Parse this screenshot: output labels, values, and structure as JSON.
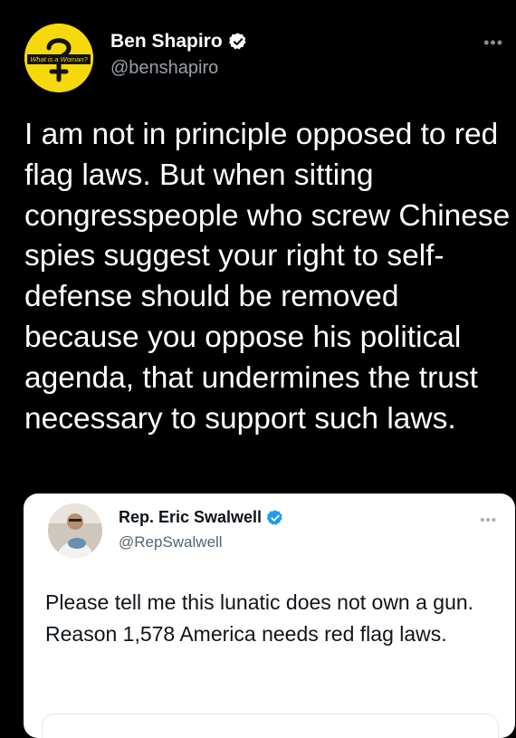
{
  "tweet": {
    "avatar_text": "What is a Woman?",
    "name": "Ben Shapiro",
    "handle": "@benshapiro",
    "more_label": "•••",
    "text": "I am not in principle opposed to red flag laws. But when sitting congresspeople who screw Chinese spies suggest your right to self-defense should be removed because you oppose his political agenda, that undermines the trust necessary to support such laws."
  },
  "quoted_tweet": {
    "name": "Rep. Eric Swalwell",
    "handle": "@RepSwalwell",
    "more_label": "•••",
    "text": "Please tell me this lunatic does not own a gun. Reason 1,578 America needs red flag laws."
  },
  "colors": {
    "background": "#000000",
    "avatar_yellow": "#f5d90a",
    "verified_blue": "#1d9bf0",
    "handle_gray": "#9aa0a6"
  },
  "icons": {
    "verified": "verified-badge-icon",
    "more": "more-horizontal-icon"
  }
}
